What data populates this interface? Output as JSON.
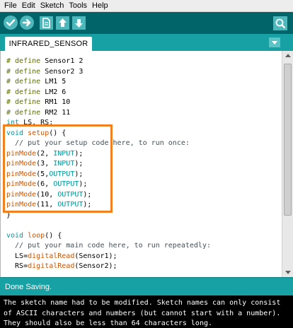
{
  "menu": [
    "File",
    "Edit",
    "Sketch",
    "Tools",
    "Help"
  ],
  "toolbar": {
    "icons": [
      "verify-icon",
      "upload-icon",
      "new-icon",
      "open-icon",
      "save-icon",
      "serial-monitor-icon"
    ],
    "colors": {
      "bar": "#006468",
      "button": "#4db7bb"
    }
  },
  "tabs": [
    "INFRARED_SENSOR"
  ],
  "code": [
    {
      "k": "def",
      "name": "Sensor1",
      "val": "2"
    },
    {
      "k": "def",
      "name": "Sensor2",
      "val": "3"
    },
    {
      "k": "def",
      "name": "LM1",
      "val": "5"
    },
    {
      "k": "def",
      "name": "LM2",
      "val": "6"
    },
    {
      "k": "def",
      "name": "RM1",
      "val": "10"
    },
    {
      "k": "def",
      "name": "RM2",
      "val": "11"
    },
    {
      "k": "int",
      "text": " LS, RS;"
    },
    {
      "k": "setup"
    },
    {
      "k": "cmt",
      "text": "  // put your setup code here, to run once:"
    },
    {
      "k": "pin",
      "pin": "2",
      "mode": "INPUT",
      "sep": ", "
    },
    {
      "k": "pin",
      "pin": "3",
      "mode": "INPUT",
      "sep": ", "
    },
    {
      "k": "pin",
      "pin": "5",
      "mode": "OUTPUT",
      "sep": ","
    },
    {
      "k": "pin",
      "pin": "6",
      "mode": "OUTPUT",
      "sep": ", "
    },
    {
      "k": "pin",
      "pin": "10",
      "mode": "OUTPUT",
      "sep": ", "
    },
    {
      "k": "pin",
      "pin": "11",
      "mode": "OUTPUT",
      "sep": ", "
    },
    {
      "k": "plain",
      "text": "}"
    },
    {
      "k": "plain",
      "text": ""
    },
    {
      "k": "loop"
    },
    {
      "k": "cmt",
      "text": "  // put your main code here, to run repeatedly:"
    },
    {
      "k": "read",
      "var": "  LS",
      "arg": "Sensor1"
    },
    {
      "k": "read",
      "var": "  RS",
      "arg": "Sensor2"
    }
  ],
  "tokens": {
    "define": "# define",
    "int": "int",
    "void": "void",
    "setup": " setup",
    "loop": " loop",
    "brace": "() {",
    "pinMode": "pinMode",
    "digitalRead": "digitalRead"
  },
  "colors": {
    "define": "#5e6d03",
    "type": "#00979c",
    "function": "#d35400",
    "constant": "#00979c",
    "highlight_box": "#f18021",
    "status_bar": "#17a1a5"
  },
  "status": "Done Saving.",
  "console": [
    "The sketch name had to be modified. Sketch names can only consist",
    "of ASCII characters and numbers (but cannot start with a number).",
    "They should also be less than 64 characters long."
  ]
}
